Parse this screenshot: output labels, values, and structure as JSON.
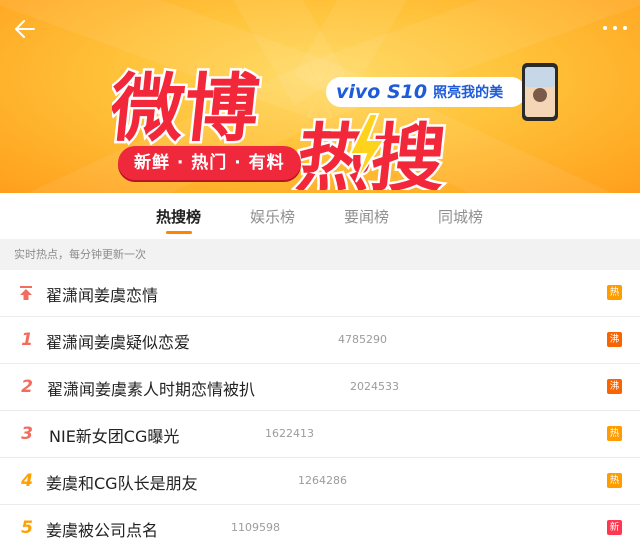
{
  "banner": {
    "logo_text": "微博热搜",
    "tagline": "新鲜 · 热门 · 有料",
    "ad_brand": "vivo S10",
    "ad_text": "照亮我的美"
  },
  "tabs": [
    {
      "label": "热搜榜",
      "active": true
    },
    {
      "label": "娱乐榜",
      "active": false
    },
    {
      "label": "要闻榜",
      "active": false
    },
    {
      "label": "同城榜",
      "active": false
    }
  ],
  "section_header": "实时热点，每分钟更新一次",
  "colors": {
    "hot": "#ff9c00",
    "boil": "#f86400",
    "new": "#ff3852",
    "rank_top": "#f26d5f",
    "rank_other": "#ffa000"
  },
  "hot_list": [
    {
      "rank": "",
      "pinned": true,
      "title": "翟潇闻姜虞恋情",
      "count": "",
      "badge": "热",
      "badge_type": "hot"
    },
    {
      "rank": "1",
      "pinned": false,
      "title": "翟潇闻姜虞疑似恋爱",
      "count": "4785290",
      "badge": "沸",
      "badge_type": "boil"
    },
    {
      "rank": "2",
      "pinned": false,
      "title": "翟潇闻姜虞素人时期恋情被扒",
      "count": "2024533",
      "badge": "沸",
      "badge_type": "boil"
    },
    {
      "rank": "3",
      "pinned": false,
      "title": "NIE新女团CG曝光",
      "count": "1622413",
      "badge": "热",
      "badge_type": "hot"
    },
    {
      "rank": "4",
      "pinned": false,
      "title": "姜虞和CG队长是朋友",
      "count": "1264286",
      "badge": "热",
      "badge_type": "hot"
    },
    {
      "rank": "5",
      "pinned": false,
      "title": "姜虞被公司点名",
      "count": "1109598",
      "badge": "新",
      "badge_type": "new"
    }
  ]
}
